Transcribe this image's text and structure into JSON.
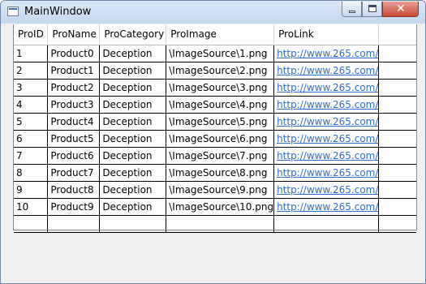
{
  "window": {
    "title": "MainWindow",
    "close_glyph": "✕"
  },
  "grid": {
    "columns": [
      "ProID",
      "ProName",
      "ProCategory",
      "ProImage",
      "ProLink"
    ],
    "rows": [
      [
        "1",
        "Product0",
        "Deception",
        "\\ImageSource\\1.png",
        "http://www.265.com/"
      ],
      [
        "2",
        "Product1",
        "Deception",
        "\\ImageSource\\2.png",
        "http://www.265.com/"
      ],
      [
        "3",
        "Product2",
        "Deception",
        "\\ImageSource\\3.png",
        "http://www.265.com/"
      ],
      [
        "4",
        "Product3",
        "Deception",
        "\\ImageSource\\4.png",
        "http://www.265.com/"
      ],
      [
        "5",
        "Product4",
        "Deception",
        "\\ImageSource\\5.png",
        "http://www.265.com/"
      ],
      [
        "6",
        "Product5",
        "Deception",
        "\\ImageSource\\6.png",
        "http://www.265.com/"
      ],
      [
        "7",
        "Product6",
        "Deception",
        "\\ImageSource\\7.png",
        "http://www.265.com/"
      ],
      [
        "8",
        "Product7",
        "Deception",
        "\\ImageSource\\8.png",
        "http://www.265.com/"
      ],
      [
        "9",
        "Product8",
        "Deception",
        "\\ImageSource\\9.png",
        "http://www.265.com/"
      ],
      [
        "10",
        "Product9",
        "Deception",
        "\\ImageSource\\10.png",
        "http://www.265.com/"
      ]
    ]
  },
  "colors": {
    "link": "#2c6ecb",
    "grid_line": "#000000",
    "window_bg": "#f0f0f0"
  },
  "icons": {
    "app": "window-app-icon",
    "minimize": "minimize-icon",
    "maximize": "maximize-icon",
    "close": "close-icon"
  }
}
